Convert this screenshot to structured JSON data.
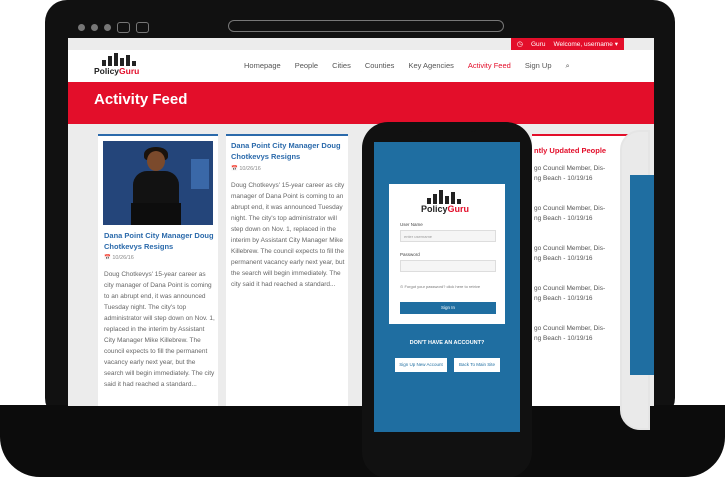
{
  "topbar": {
    "clock_icon": "clock-icon",
    "user_label": "Guru",
    "welcome": "Welcome, username ▾"
  },
  "logo": {
    "policy": "Policy",
    "guru": "Guru"
  },
  "nav": {
    "items": [
      "Homepage",
      "People",
      "Cities",
      "Counties",
      "Key Agencies",
      "Activity Feed",
      "Sign Up",
      "⌕"
    ]
  },
  "banner": {
    "title": "Activity Feed"
  },
  "cards": [
    {
      "title": "Dana Point City Manager Doug Chotkevys Resigns",
      "date": "📅 10/26/16",
      "body": "Doug Chotkevys' 15-year career as city manager of Dana Point is coming to an abrupt end, it was announced Tuesday night. The city's top administrator will step down on Nov. 1, replaced in the interim by Assistant City Manager Mike Killebrew. The council expects to fill the permanent vacancy early next year, but the search will begin immediately. The city said it had reached a standard..."
    },
    {
      "title": "Dana Point City Manager Doug Chotkevys Resigns",
      "date": "📅 10/26/16",
      "body": "Doug Chotkevys' 15-year career as city manager of Dana Point is coming to an abrupt end, it was announced Tuesday night. The city's top administrator will step down on Nov. 1, replaced in the interim by Assistant City Manager Mike Killebrew. The council expects to fill the permanent vacancy early next year, but the search will begin immediately. The city said it had reached a standard..."
    }
  ],
  "recent": {
    "title": "ntly Updated People",
    "items": [
      "go Council Member, Dis-",
      "ng Beach - 10/19/16",
      "go Council Member, Dis-",
      "ng Beach - 10/19/16",
      "go Council Member, Dis-",
      "ng Beach - 10/19/16",
      "go Council Member, Dis-",
      "ng Beach - 10/19/16",
      "go Council Member, Dis-",
      "ng Beach - 10/19/16"
    ]
  },
  "mobile": {
    "username_label": "User Name",
    "username_placeholder": "enter username",
    "password_label": "Password",
    "forgot": "⊙ Forgot your password? click here to retrive",
    "signin": "Sign In",
    "no_account": "DON'T HAVE AN ACCOUNT?",
    "signup_btn": "Sign Up New Account",
    "back_btn": "Back To Main Site"
  }
}
